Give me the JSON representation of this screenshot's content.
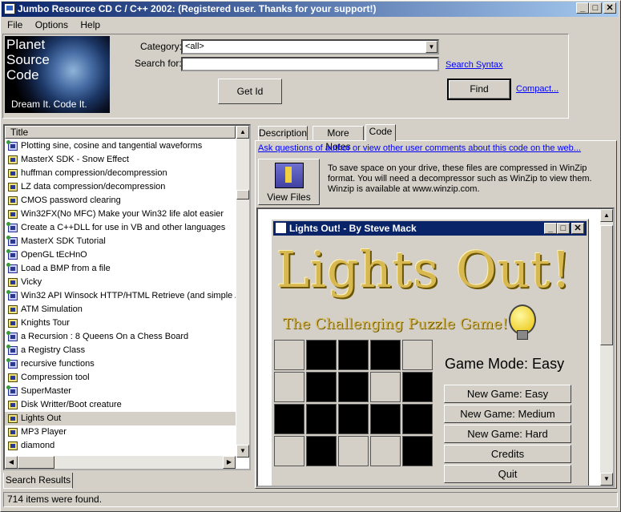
{
  "window": {
    "title": "Jumbo Resource CD C / C++ 2002: (Registered user.  Thanks for your support!)",
    "controls": [
      "_",
      "□",
      "✕"
    ]
  },
  "menu": [
    {
      "label": "File"
    },
    {
      "label": "Options"
    },
    {
      "label": "Help"
    }
  ],
  "logo": {
    "line1": "Planet",
    "line2": "Source",
    "line3": "Code",
    "tagline": "Dream It.  Code It."
  },
  "search": {
    "category_label": "Category:",
    "category_value": "<all>",
    "search_label": "Search for:",
    "search_value": "",
    "get_id_label": "Get Id",
    "find_label": "Find",
    "syntax_link": "Search Syntax",
    "compact_link": "Compact..."
  },
  "list": {
    "column": "Title",
    "items": [
      {
        "label": "Plotting sine, cosine and tangential waveforms",
        "icon": "multi-language-icon"
      },
      {
        "label": "MasterX SDK - Snow Effect",
        "icon": "code-icon"
      },
      {
        "label": "huffman compression/decompression",
        "icon": "code-icon"
      },
      {
        "label": "LZ data compression/decompression",
        "icon": "code-icon"
      },
      {
        "label": "CMOS password clearing",
        "icon": "code-icon"
      },
      {
        "label": "Win32FX(No MFC) Make your Win32 life alot easier",
        "icon": "code-icon"
      },
      {
        "label": "Create a C++DLL for use in  VB and other languages",
        "icon": "multi-language-icon"
      },
      {
        "label": "MasterX SDK Tutorial",
        "icon": "multi-language-icon"
      },
      {
        "label": "OpenGL tEcHnO",
        "icon": "multi-language-icon"
      },
      {
        "label": "Load a BMP from a file",
        "icon": "multi-language-icon"
      },
      {
        "label": "Vicky",
        "icon": "code-icon"
      },
      {
        "label": "Win32 API Winsock HTTP/HTML Retrieve (and simple / ",
        "icon": "multi-language-icon"
      },
      {
        "label": "ATM Simulation",
        "icon": "code-icon"
      },
      {
        "label": "Knights Tour",
        "icon": "code-icon"
      },
      {
        "label": "a Recursion : 8 Queens On a Chess Board",
        "icon": "multi-language-icon"
      },
      {
        "label": "a Registry Class",
        "icon": "multi-language-icon"
      },
      {
        "label": "recursive functions",
        "icon": "multi-language-icon"
      },
      {
        "label": "Compression tool",
        "icon": "code-icon"
      },
      {
        "label": "SuperMaster",
        "icon": "multi-language-icon"
      },
      {
        "label": "Disk Writter/Boot creature",
        "icon": "code-icon"
      },
      {
        "label": "Lights Out",
        "icon": "code-icon",
        "selected": true
      },
      {
        "label": "MP3 Player",
        "icon": "code-icon"
      },
      {
        "label": "diamond",
        "icon": "code-icon"
      }
    ],
    "bottom_tab": "Search Results"
  },
  "tabs": [
    {
      "label": "Description"
    },
    {
      "label": "More Notes"
    },
    {
      "label": "Code",
      "active": true
    }
  ],
  "detail": {
    "comments_link": "Ask questions of author or view other user comments about this code on the web...",
    "view_files": "View Files",
    "note": "To save space on your drive, these files are compressed in WinZip format.  You will need a decompressor such as WinZip to view them.  Winzip is available at www.winzip.com."
  },
  "game": {
    "title": "Lights Out! - By Steve Mack",
    "heading": "Lights Out!",
    "subheading": "The Challenging Puzzle Game!",
    "mode": "Game Mode: Easy",
    "buttons": [
      "New Game: Easy",
      "New Game: Medium",
      "New Game: Hard",
      "Credits",
      "Quit"
    ],
    "board": [
      [
        0,
        1,
        1,
        1,
        0
      ],
      [
        0,
        1,
        1,
        0,
        1
      ],
      [
        1,
        1,
        1,
        1,
        1
      ],
      [
        0,
        1,
        0,
        0,
        1
      ]
    ]
  },
  "status": {
    "text": "714 items were found."
  }
}
